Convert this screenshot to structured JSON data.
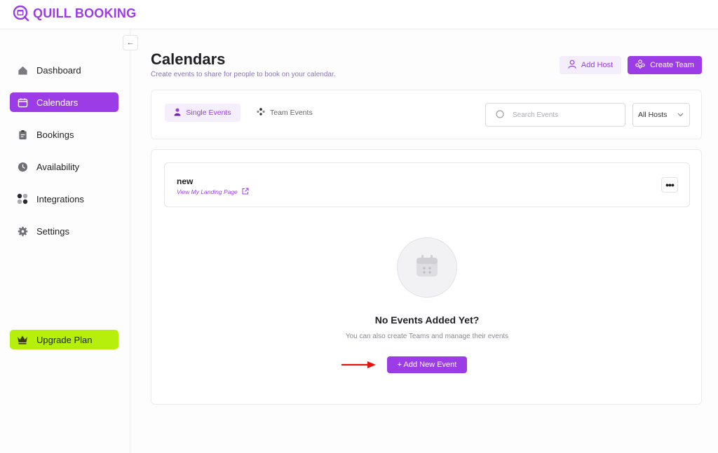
{
  "brand": {
    "name": "QUILL BOOKING",
    "color": "#9b3ce6"
  },
  "sidebar": {
    "collapse_icon": "arrow-left-icon",
    "items": [
      {
        "label": "Dashboard",
        "icon": "home-icon"
      },
      {
        "label": "Calendars",
        "icon": "calendar-icon",
        "active": true
      },
      {
        "label": "Bookings",
        "icon": "clipboard-icon"
      },
      {
        "label": "Availability",
        "icon": "clock-icon"
      },
      {
        "label": "Integrations",
        "icon": "grid-dots-icon"
      },
      {
        "label": "Settings",
        "icon": "gear-icon"
      }
    ],
    "upgrade": {
      "label": "Upgrade Plan",
      "icon": "crown-icon",
      "color": "#b7ef0c"
    }
  },
  "header": {
    "title": "Calendars",
    "subtitle": "Create events to share for people to book on your calendar.",
    "add_host_label": "Add Host",
    "create_team_label": "Create Team"
  },
  "filters": {
    "tabs": [
      {
        "label": "Single Events",
        "active": true
      },
      {
        "label": "Team Events",
        "active": false
      }
    ],
    "search_placeholder": "Search Events",
    "hosts_select": "All Hosts"
  },
  "calendar": {
    "name": "new",
    "landing_link": "View My Landing Page",
    "more_label": "•••"
  },
  "empty_state": {
    "title": "No Events Added Yet?",
    "subtitle": "You can also create Teams and manage their events",
    "button_label": "+ Add New Event"
  },
  "colors": {
    "accent": "#9b3ce6",
    "accent_light": "#f4eefc",
    "annotation_arrow": "#e8120c"
  }
}
